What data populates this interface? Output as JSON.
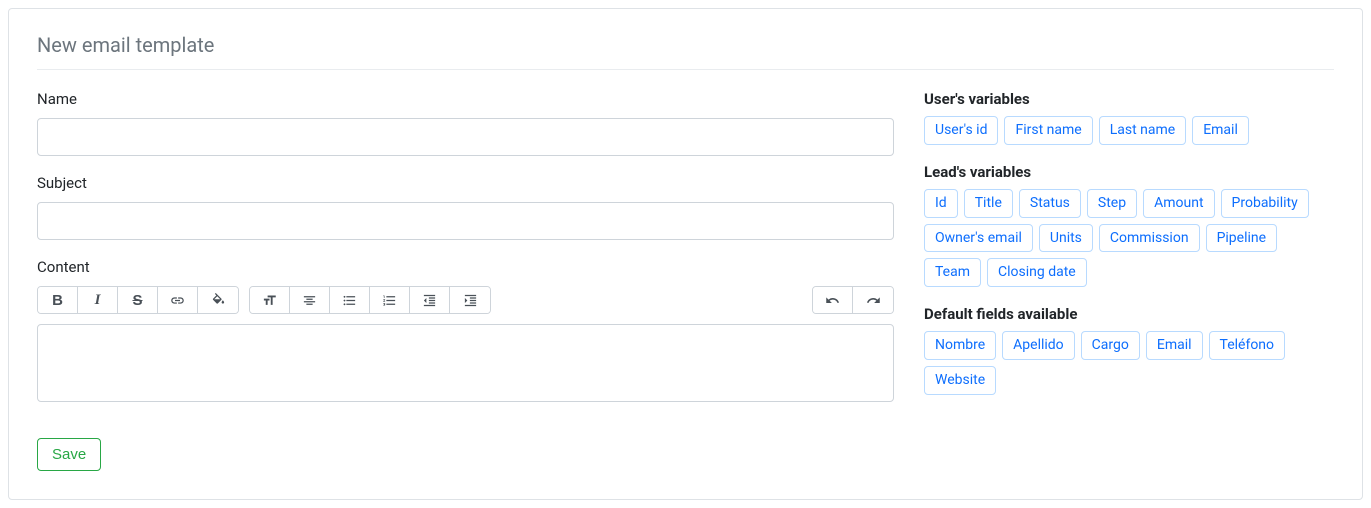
{
  "page_title": "New email template",
  "form": {
    "name_label": "Name",
    "name_value": "",
    "subject_label": "Subject",
    "subject_value": "",
    "content_label": "Content",
    "save_label": "Save"
  },
  "user_variables": {
    "heading": "User's variables",
    "items": [
      "User's id",
      "First name",
      "Last name",
      "Email"
    ]
  },
  "lead_variables": {
    "heading": "Lead's variables",
    "items": [
      "Id",
      "Title",
      "Status",
      "Step",
      "Amount",
      "Probability",
      "Owner's email",
      "Units",
      "Commission",
      "Pipeline",
      "Team",
      "Closing date"
    ]
  },
  "default_fields": {
    "heading": "Default fields available",
    "items": [
      "Nombre",
      "Apellido",
      "Cargo",
      "Email",
      "Teléfono",
      "Website"
    ]
  }
}
